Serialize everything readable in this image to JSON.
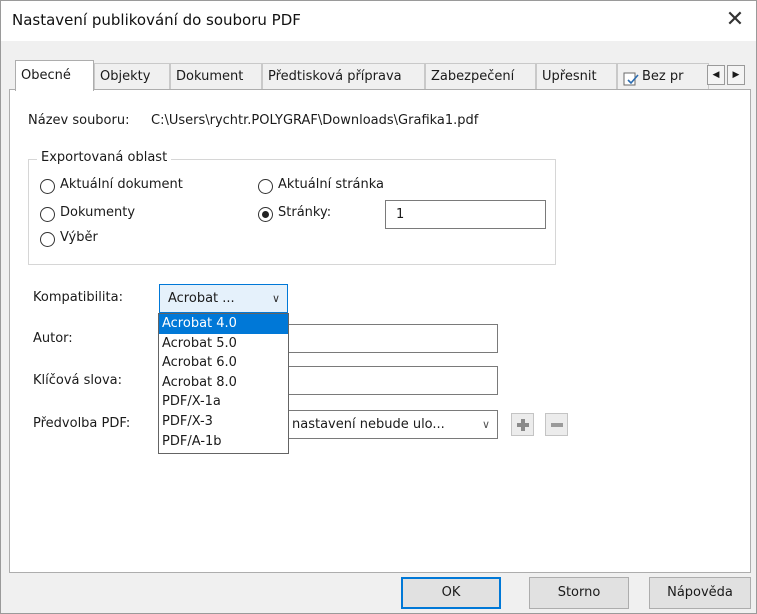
{
  "window": {
    "title": "Nastavení publikování do souboru PDF",
    "close_glyph": "✕"
  },
  "tabs": [
    {
      "label": "Obecné"
    },
    {
      "label": "Objekty"
    },
    {
      "label": "Dokument"
    },
    {
      "label": "Předtisková příprava"
    },
    {
      "label": "Zabezpečení"
    },
    {
      "label": "Upřesnit"
    },
    {
      "label": "Bez pr"
    }
  ],
  "tab_scroll": {
    "left": "◀",
    "right": "▶"
  },
  "file": {
    "label": "Název souboru:",
    "value": "C:\\Users\\rychtr.POLYGRAF\\Downloads\\Grafika1.pdf"
  },
  "export_area": {
    "title": "Exportovaná oblast",
    "options": {
      "current_document": "Aktuální dokument",
      "documents": "Dokumenty",
      "selection": "Výběr",
      "current_page": "Aktuální stránka",
      "pages": "Stránky:"
    },
    "selected": "pages",
    "pages_value": "1"
  },
  "compatibility": {
    "label": "Kompatibilita:",
    "value": "Acrobat ...",
    "options": [
      "Acrobat 4.0",
      "Acrobat 5.0",
      "Acrobat 6.0",
      "Acrobat 8.0",
      "PDF/X-1a",
      "PDF/X-3",
      "PDF/A-1b"
    ],
    "highlighted": "Acrobat 4.0"
  },
  "author": {
    "label": "Autor:",
    "value": ""
  },
  "keywords": {
    "label": "Klíčová slova:",
    "value": ""
  },
  "preset": {
    "label": "Předvolba PDF:",
    "value": "nastavení nebude ulo..."
  },
  "buttons": {
    "ok": "OK",
    "cancel": "Storno",
    "help": "Nápověda"
  },
  "colors": {
    "accent": "#0078d7",
    "dialog_bg": "#f0f0f0"
  }
}
